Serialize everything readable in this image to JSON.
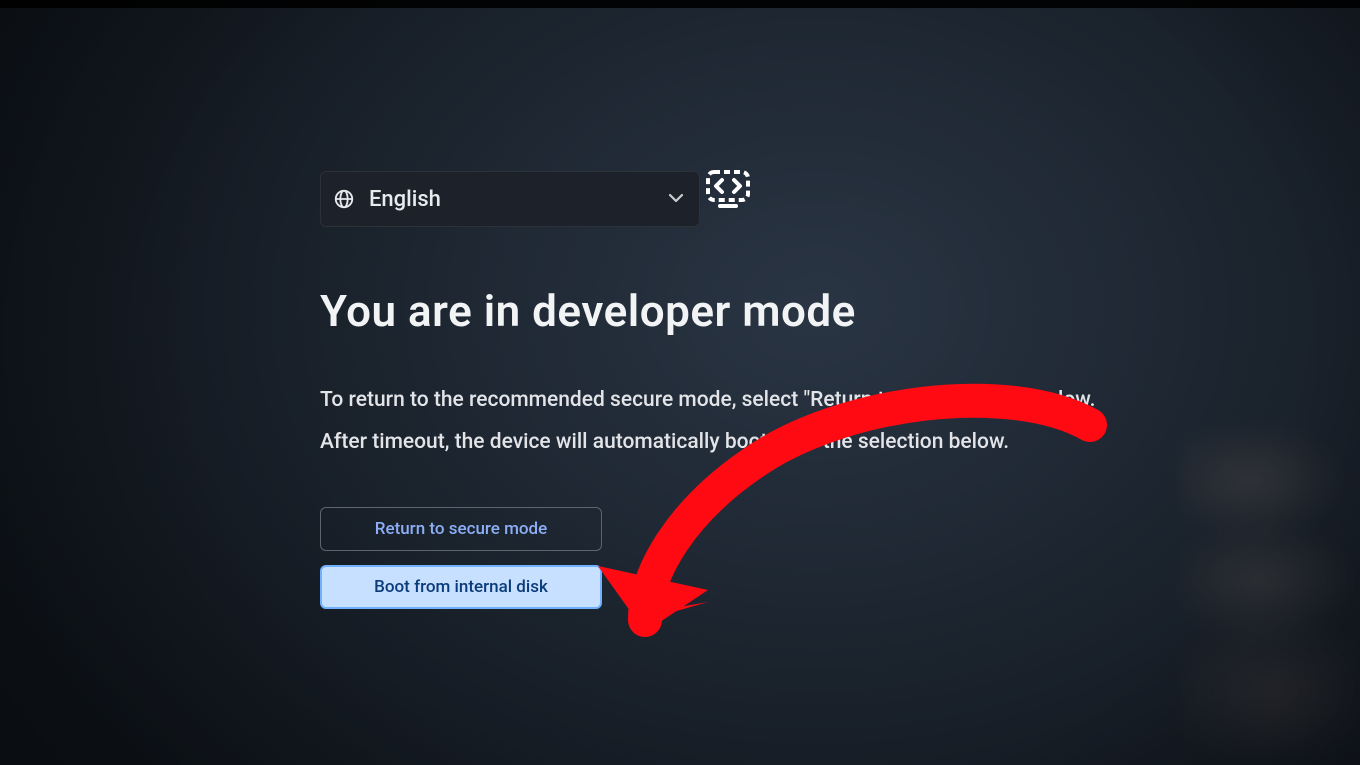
{
  "language": {
    "selected_label": "English"
  },
  "heading": "You are in developer mode",
  "body_line1": "To return to the recommended secure mode, select \"Return to secure mode\" below.",
  "body_line2": "After timeout, the device will automatically boot from the selection below.",
  "buttons": {
    "return_secure_label": "Return to secure mode",
    "boot_internal_label": "Boot from internal disk"
  },
  "annotation": {
    "arrow_color": "#ff0a12"
  }
}
